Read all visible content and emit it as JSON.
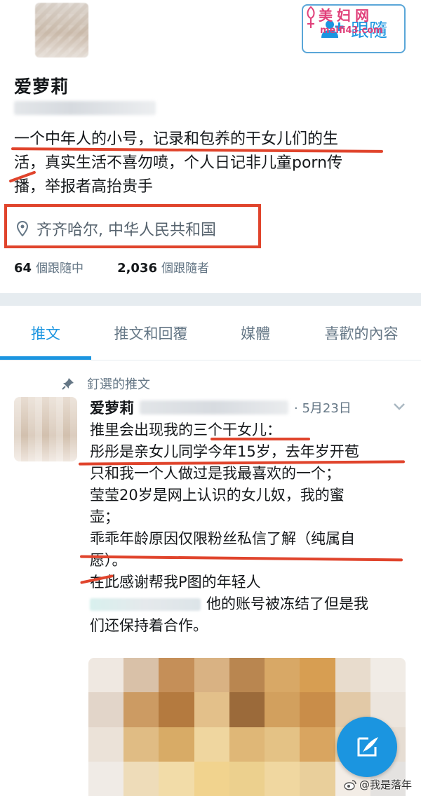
{
  "header": {
    "follow_label": "跟隨",
    "watermark_title": "美妇网",
    "watermark_url": "meifi43.com"
  },
  "profile": {
    "display_name": "爱萝莉",
    "bio_lines": [
      "一个中年人的小号，记录和包养的干女儿们的生",
      "活，真实生活不喜勿喷，个人日记非儿童porn传",
      "播，举报者高抬贵手"
    ],
    "location": "齐齐哈尔, 中华人民共和国",
    "following_count": "64",
    "following_label": "個跟隨中",
    "followers_count": "2,036",
    "followers_label": "個跟隨者"
  },
  "tabs": [
    {
      "label": "推文"
    },
    {
      "label": "推文和回覆"
    },
    {
      "label": "媒體"
    },
    {
      "label": "喜歡的內容"
    }
  ],
  "tweet": {
    "pinned_label": "釘選的推文",
    "author_name": "爱萝莉",
    "date": "· 5月23日",
    "lines": [
      "推里会出现我的三个干女儿：",
      "彤彤是亲女儿同学今年15岁，去年岁开苞",
      "只和我一个人做过是我最喜欢的一个；",
      "莹莹20岁是网上认识的女儿奴，我的蜜",
      "壶；",
      "乖乖年龄原因仅限粉丝私信了解（纯属自",
      "愿）。",
      "在此感谢帮我P图的年轻人",
      "他的账号被冻结了但是我",
      "们还保持着合作。"
    ]
  },
  "footer": {
    "weibo_credit": "@我是落年"
  },
  "colors": {
    "accent": "#1b95e0",
    "annotation_red": "#e0442c",
    "watermark_pink": "#e0407a"
  },
  "icons": [
    "person-add-icon",
    "location-pin-icon",
    "pin-icon",
    "chevron-down-icon",
    "compose-feather-icon",
    "weibo-icon"
  ]
}
